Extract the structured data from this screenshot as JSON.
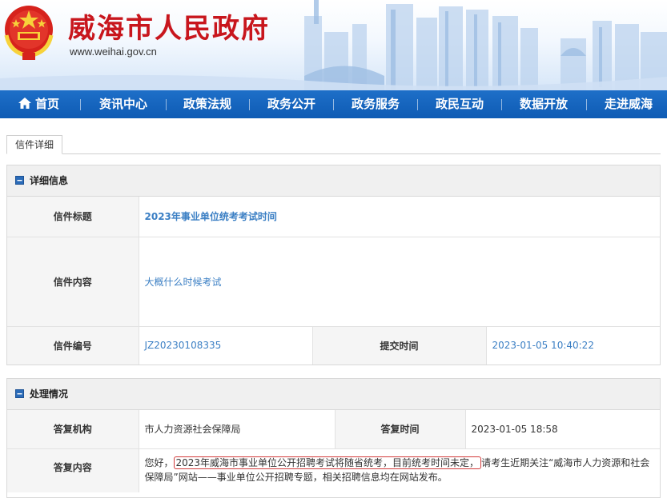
{
  "header": {
    "site_title": "威海市人民政府",
    "site_url": "www.weihai.gov.cn"
  },
  "nav": {
    "items": [
      {
        "label": "首页",
        "icon": "home-icon"
      },
      {
        "label": "资讯中心"
      },
      {
        "label": "政策法规"
      },
      {
        "label": "政务公开"
      },
      {
        "label": "政务服务"
      },
      {
        "label": "政民互动"
      },
      {
        "label": "数据开放"
      },
      {
        "label": "走进威海"
      }
    ]
  },
  "tab": {
    "label": "信件详细"
  },
  "detail": {
    "heading": "详细信息",
    "title_label": "信件标题",
    "title_value": "2023年事业单位统考考试时间",
    "content_label": "信件内容",
    "content_value": "大概什么时候考试",
    "number_label": "信件编号",
    "number_value": "JZ20230108335",
    "submit_label": "提交时间",
    "submit_value": "2023-01-05 10:40:22"
  },
  "handling": {
    "heading": "处理情况",
    "org_label": "答复机构",
    "org_value": "市人力资源社会保障局",
    "time_label": "答复时间",
    "time_value": "2023-01-05 18:58",
    "reply_label": "答复内容",
    "reply_prefix": "您好，",
    "reply_highlight": "2023年威海市事业单位公开招聘考试将随省统考，目前统考时间未定，",
    "reply_suffix": "请考生近期关注“威海市人力资源和社会保障局”网站——事业单位公开招聘专题，相关招聘信息均在网站发布。"
  },
  "colors": {
    "nav_blue": "#0e5bb4",
    "title_red": "#c8161d",
    "link_blue": "#3b7fc4",
    "highlight_red": "#d23a3a"
  }
}
